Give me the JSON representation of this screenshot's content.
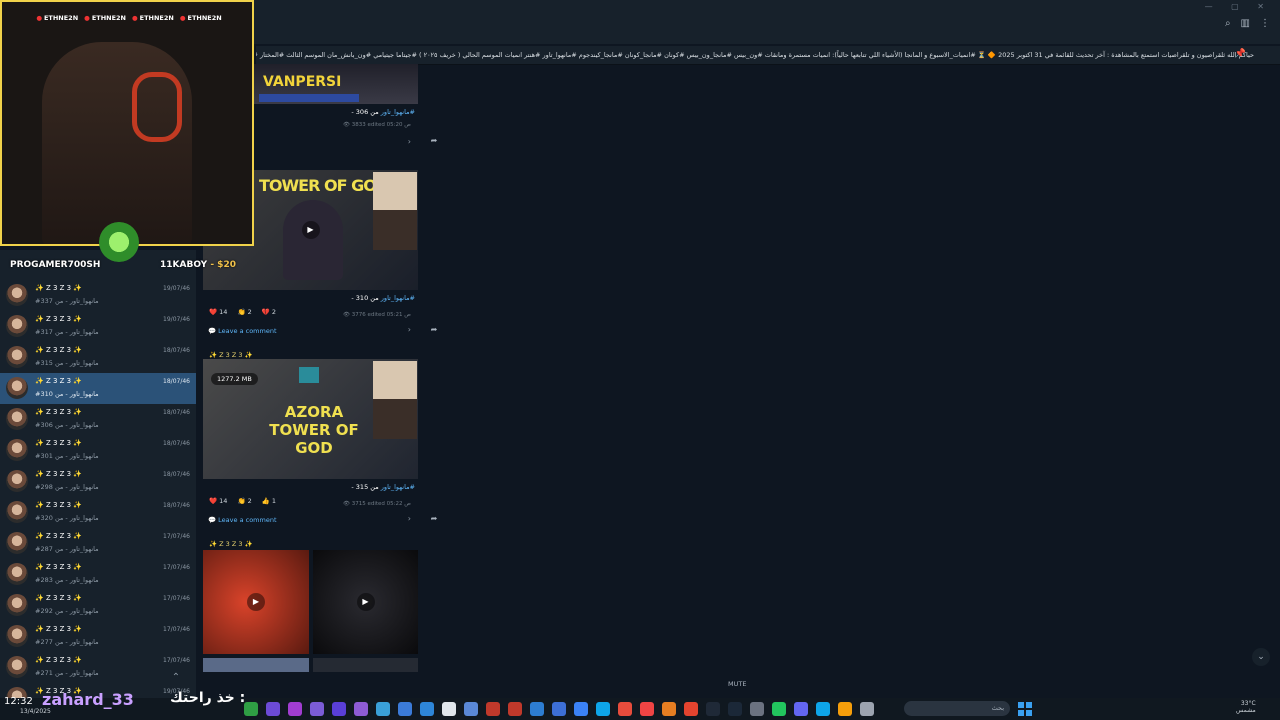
{
  "pinned_text": "حياكم الله ثلقراصيون و تلقراصيات استمتع بالمشاهدة : آخر تحديث للقائمة في 31 اكتوبر 2025 🔶 ⏳ #انميات_الاسبوع و المانجا (الأشياء اللي تتابعها حالياً): انميات مستمرة ومانقات #ون_بيس #مانجا_ون_بيس #كونان #مانجا_كونان #مانجا_كيندجوم #مانهوا_تاور #هنتر انميات الموسم الحالي ( خريف ٢٠٢٥ ) #جيتاما جيتيامي #ون_بانش_مان الموسم الثالث #المختار #ساي_قاصيلي ... ",
  "stream": {
    "socials": [
      "ETHNE2N",
      "ETHNE2N",
      "ETHNE2N",
      "ETHNE2N"
    ],
    "alert_left": "PROGAMER700SH",
    "alert_right_user": "11KABOY",
    "alert_right_amount": "- $20",
    "chat_user": "zahard_33",
    "chat_msg": "خذ راحتك :",
    "clock": "12:32",
    "clock_sub": "13/4/2025"
  },
  "sidebar": {
    "items": [
      {
        "name": "✨ Z 3 Z 3 ✨",
        "preview": "#مانهوا_تاور - من 337",
        "date": "19/07/46"
      },
      {
        "name": "✨ Z 3 Z 3 ✨",
        "preview": "#مانهوا_تاور - من 317",
        "date": "19/07/46"
      },
      {
        "name": "✨ Z 3 Z 3 ✨",
        "preview": "#مانهوا_تاور - من 315",
        "date": "18/07/46"
      },
      {
        "name": "✨ Z 3 Z 3 ✨",
        "preview": "#مانهوا_تاور - من 310",
        "date": "18/07/46"
      },
      {
        "name": "✨ Z 3 Z 3 ✨",
        "preview": "#مانهوا_تاور - من 306",
        "date": "18/07/46"
      },
      {
        "name": "✨ Z 3 Z 3 ✨",
        "preview": "#مانهوا_تاور - من 301",
        "date": "18/07/46"
      },
      {
        "name": "✨ Z 3 Z 3 ✨",
        "preview": "#مانهوا_تاور - من 298",
        "date": "18/07/46"
      },
      {
        "name": "✨ Z 3 Z 3 ✨",
        "preview": "#مانهوا_تاور - من 320",
        "date": "18/07/46"
      },
      {
        "name": "✨ Z 3 Z 3 ✨",
        "preview": "#مانهوا_تاور - من 287",
        "date": "17/07/46"
      },
      {
        "name": "✨ Z 3 Z 3 ✨",
        "preview": "#مانهوا_تاور - من 283",
        "date": "17/07/46"
      },
      {
        "name": "✨ Z 3 Z 3 ✨",
        "preview": "#مانهوا_تاور - من 292",
        "date": "17/07/46"
      },
      {
        "name": "✨ Z 3 Z 3 ✨",
        "preview": "#مانهوا_تاور - من 277",
        "date": "17/07/46"
      },
      {
        "name": "✨ Z 3 Z 3 ✨",
        "preview": "#مانهوا_تاور - من 271",
        "date": "17/07/46"
      },
      {
        "name": "✨ Z 3 Z 3 ✨",
        "preview": "#مانهوا_تاور - من 313",
        "date": "19/07/46"
      }
    ]
  },
  "posts": [
    {
      "banner": "VANPERSI",
      "caption_num": "من 306 -",
      "caption_tag": "#مانهوا_تاور",
      "views": "3833",
      "edited": "edited 05:20 ص",
      "reacts": "👏 1",
      "comment": "t"
    },
    {
      "banner": "TOWER OF GO",
      "caption_num": "من 310 -",
      "caption_tag": "#مانهوا_تاور",
      "views": "3776",
      "edited": "edited 05:21 ص",
      "reacts": [
        "❤️ 14",
        "👏 2",
        "💔 2"
      ],
      "comment": "Leave a comment",
      "sender": "✨ Z 3 Z 3 ✨"
    },
    {
      "banner": "AZORA TOWER OF GOD",
      "caption_num": "من 315 -",
      "caption_tag": "#مانهوا_تاور",
      "views": "3715",
      "edited": "edited 05:22 ص",
      "size": "1277.2 MB",
      "reacts": [
        "❤️ 14",
        "👏 2",
        "👍 1"
      ],
      "comment": "Leave a comment",
      "sender": "✨ Z 3 Z 3 ✨"
    }
  ],
  "mute_label": "MUTE",
  "search_placeholder": "بحث",
  "temp": "33°C",
  "temp_sub": "مشمس"
}
